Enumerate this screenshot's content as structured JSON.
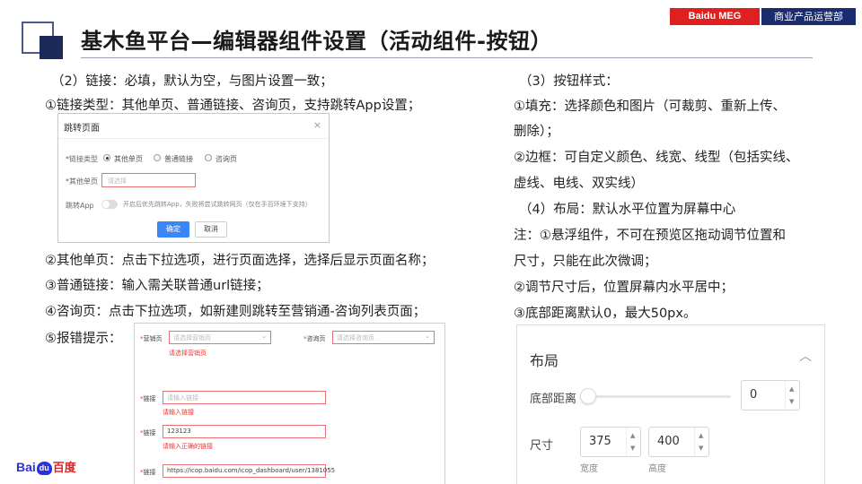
{
  "header": {
    "title": "基木鱼平台—编辑器组件设置（活动组件-按钮）",
    "badge_left": "Baidu MEG",
    "badge_right": "商业产品运营部"
  },
  "left": {
    "line1": "（2）链接：必填，默认为空，与图片设置一致；",
    "line2": "①链接类型：其他单页、普通链接、咨询页，支持跳转App设置；",
    "line3": "②其他单页：点击下拉选项，进行页面选择，选择后显示页面名称；",
    "line4": "③普通链接：输入需关联普通url链接；",
    "line5": "④咨询页：点击下拉选项，如新建则跳转至营销通-咨询列表页面；",
    "line6": "⑤报错提示："
  },
  "dialog": {
    "title": "跳转页面",
    "close": "×",
    "link_type_label": "*链接类型",
    "opt_other": "其他单页",
    "opt_normal": "普通链接",
    "opt_consult": "咨询页",
    "other_label": "*其他单页",
    "select_ph": "请选择",
    "app_label": "跳转App",
    "app_hint": "开启后优先跳转App，失败将尝试跳转网页（仅在手百环境下支持）",
    "ok": "确定",
    "cancel": "取消"
  },
  "errform": {
    "mkt_label": "营销页",
    "mkt_ph": "请选择营销页",
    "mkt_err": "请选择营销页",
    "consult_label": "咨询页",
    "consult_ph": "请选择咨询页",
    "link1_label": "链接",
    "link1_ph": "请输入链接",
    "link1_err": "请输入链接",
    "link2_label": "链接",
    "link2_val": "123123",
    "link2_err": "请输入正确的链接",
    "link3_label": "链接",
    "link3_val": "https://icop.baidu.com/icop_dashboard/user/1381055"
  },
  "right": {
    "line1": "（3）按钮样式：",
    "line2": "①填充：选择颜色和图片（可裁剪、重新上传、",
    "line3": "删除）；",
    "line4": "②边框：可自定义颜色、线宽、线型（包括实线、",
    "line5": "虚线、电线、双实线）",
    "line6": "（4）布局：默认水平位置为屏幕中心",
    "line7": "注：①悬浮组件，不可在预览区拖动调节位置和",
    "line8": "尺寸，只能在此次微调；",
    "line9": "②调节尺寸后，位置屏幕内水平居中；",
    "line10": "③底部距离默认0，最大50px。"
  },
  "panel": {
    "title": "布局",
    "bottom_label": "底部距离",
    "bottom_value": "0",
    "size_label": "尺寸",
    "width_value": "375",
    "height_value": "400",
    "width_label": "宽度",
    "height_label": "高度"
  },
  "footer": {
    "logo_bai": "Bai",
    "logo_paw": "du",
    "logo_cn": "百度"
  }
}
